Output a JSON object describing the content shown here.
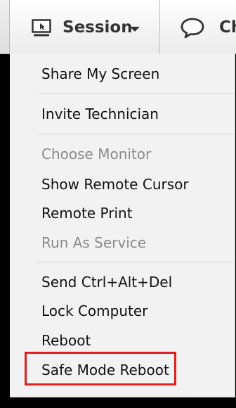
{
  "toolbar": {
    "session_label": "Session",
    "chat_label": "Ch"
  },
  "menu": {
    "items": [
      {
        "label": "Share My Screen",
        "enabled": true
      },
      {
        "label": "Invite Technician",
        "enabled": true
      },
      {
        "label": "Choose Monitor",
        "enabled": false
      },
      {
        "label": "Show Remote Cursor",
        "enabled": true
      },
      {
        "label": "Remote Print",
        "enabled": true
      },
      {
        "label": "Run As Service",
        "enabled": false
      },
      {
        "label": "Send Ctrl+Alt+Del",
        "enabled": true
      },
      {
        "label": "Lock Computer",
        "enabled": true
      },
      {
        "label": "Reboot",
        "enabled": true
      },
      {
        "label": "Safe Mode Reboot",
        "enabled": true,
        "highlighted": true
      }
    ]
  },
  "colors": {
    "highlight": "#e02020",
    "disabled_text": "#8a8a8a",
    "menu_background": "#f2f2f2"
  }
}
